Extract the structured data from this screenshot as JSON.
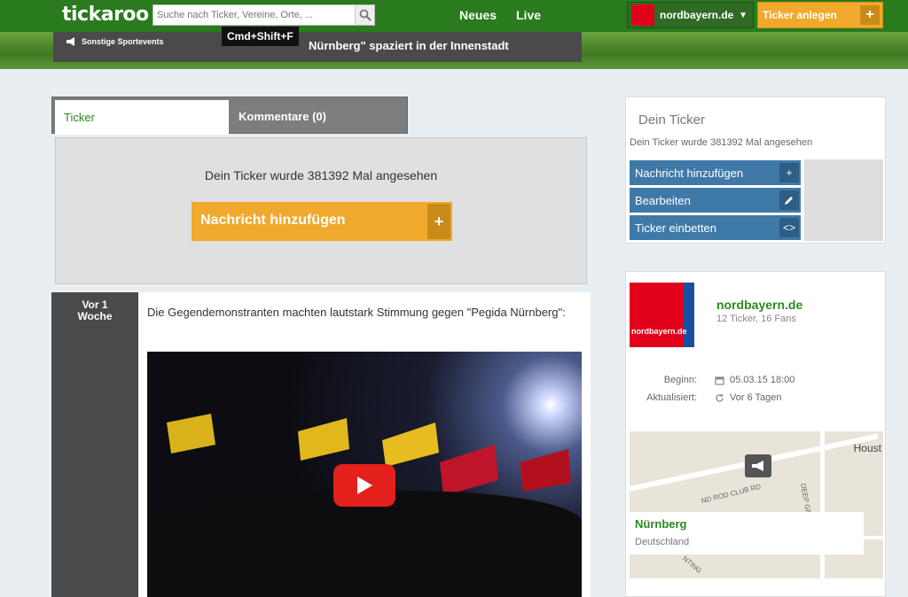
{
  "header": {
    "logo": "tickaroo",
    "search_placeholder": "Suche nach Ticker, Vereine, Orte, ...",
    "nav": [
      "Neues",
      "Live"
    ],
    "portal_name": "nordbayern.de",
    "create_label": "Ticker anlegen"
  },
  "event": {
    "category": "Sonstige Sportevents",
    "headline": "Nürnberg\" spaziert in der Innenstadt",
    "tooltip": "Cmd+Shift+F"
  },
  "tabs": {
    "ticker": "Ticker",
    "comments": "Kommentare (0)"
  },
  "viewbox": {
    "views_text": "Dein Ticker wurde 381392 Mal angesehen",
    "add_label": "Nachricht hinzufügen"
  },
  "post": {
    "time_line1": "Vor 1",
    "time_line2": "Woche",
    "text": "Die Gegendemonstranten machten lautstark Stimmung gegen \"Pegida Nürnberg\":"
  },
  "sidebar": {
    "title": "Dein Ticker",
    "views_text": "Dein Ticker wurde 381392 Mal angesehen",
    "buttons": [
      "Nachricht hinzufügen",
      "Bearbeiten",
      "Ticker einbetten"
    ],
    "publisher": {
      "logo_text": "nordbayern.de",
      "name": "nordbayern.de",
      "stats": "12 Ticker, 16 Fans"
    },
    "meta": {
      "start_label": "Beginn:",
      "start_value": "05.03.15 18:00",
      "updated_label": "Aktualisiert:",
      "updated_value": "Vor 6 Tagen"
    },
    "map": {
      "city_label": "Houst",
      "road_label_1": "ND ROD CLUB RD",
      "road_label_2": "DEEP GRASS LN",
      "road_label_3": "NTING",
      "place_name": "Nürnberg",
      "place_country": "Deutschland"
    }
  }
}
